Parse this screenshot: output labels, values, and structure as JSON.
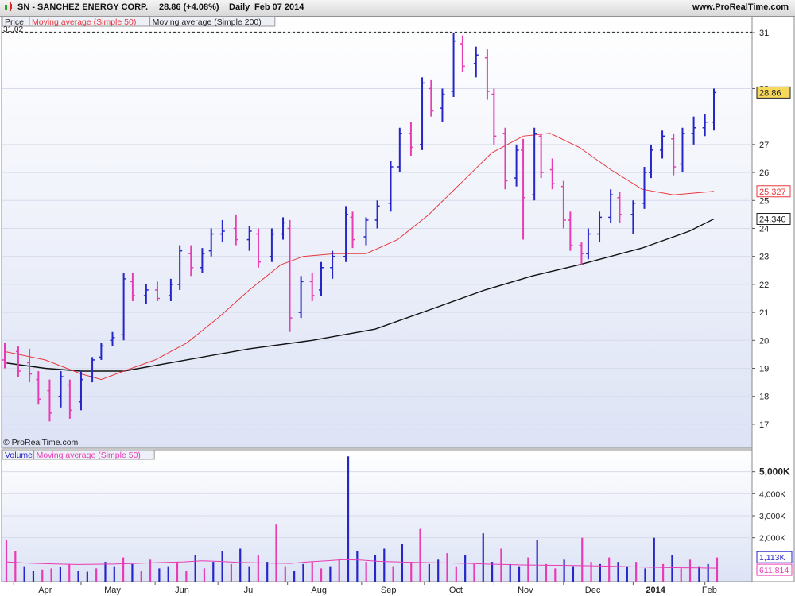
{
  "header": {
    "symbol_title": "SN - SANCHEZ ENERGY CORP.",
    "price_change": "28.86 (+4.08%)",
    "period": "Daily",
    "date": "Feb 07 2014",
    "website": "www.ProRealTime.com"
  },
  "price_panel": {
    "legend": [
      "Price",
      "Moving average (Simple 50)",
      "Moving average (Simple 200)"
    ],
    "top_value_label": "31.02",
    "copyright": "© ProRealTime.com",
    "last_price_tag": "28.86",
    "ma50_tag": "25.327",
    "ma200_tag": "24.340"
  },
  "volume_panel": {
    "legend": [
      "Volume",
      "Moving average (Simple 50)"
    ],
    "last_volume_tag": "1,113K",
    "vol_ma_tag": "611,814"
  },
  "colors": {
    "up_bar": "#2626c8",
    "down_bar": "#e83cb4",
    "ma50": "#e8383c",
    "ma200": "#111111",
    "vol_ma": "#e83cb4",
    "panel_bg_top": "#ffffff",
    "panel_bg_bottom": "#dde3f5"
  },
  "chart_data": [
    {
      "type": "ohlc",
      "title": "SN - SANCHEZ ENERGY CORP. Daily",
      "y_ticks": [
        "17",
        "18",
        "19",
        "20",
        "21",
        "22",
        "23",
        "24",
        "25",
        "26",
        "27",
        "29",
        "31"
      ],
      "ylim": [
        16.6,
        31.2
      ],
      "x_labels": [
        "Apr",
        "May",
        "Jun",
        "Jul",
        "Aug",
        "Sep",
        "Oct",
        "Nov",
        "Dec",
        "2014",
        "Feb"
      ],
      "x_range": [
        "2013-03-28",
        "2014-02-07"
      ],
      "grid": true,
      "series": [
        {
          "name": "Price",
          "type": "ohlc",
          "points": [
            [
              "2013-03-28",
              19.3,
              19.9,
              19.0,
              19.2
            ],
            [
              "2013-04-03",
              19.6,
              19.8,
              18.7,
              18.9
            ],
            [
              "2013-04-08",
              19.2,
              19.7,
              18.5,
              18.8
            ],
            [
              "2013-04-12",
              18.6,
              18.9,
              17.7,
              17.9
            ],
            [
              "2013-04-17",
              18.2,
              18.6,
              17.1,
              17.4
            ],
            [
              "2013-04-22",
              18.0,
              18.9,
              17.6,
              18.7
            ],
            [
              "2013-04-26",
              18.4,
              18.6,
              17.2,
              17.5
            ],
            [
              "2013-05-01",
              17.8,
              18.9,
              17.5,
              18.6
            ],
            [
              "2013-05-06",
              18.7,
              19.4,
              18.5,
              19.3
            ],
            [
              "2013-05-10",
              19.4,
              19.9,
              19.3,
              19.8
            ],
            [
              "2013-05-15",
              20.0,
              20.3,
              19.8,
              20.1
            ],
            [
              "2013-05-20",
              20.2,
              22.4,
              20.0,
              22.2
            ],
            [
              "2013-05-24",
              22.1,
              22.4,
              21.4,
              21.6
            ],
            [
              "2013-05-30",
              21.6,
              22.0,
              21.3,
              21.8
            ],
            [
              "2013-06-04",
              21.8,
              22.1,
              21.4,
              21.5
            ],
            [
              "2013-06-10",
              21.6,
              22.2,
              21.4,
              22.0
            ],
            [
              "2013-06-14",
              22.0,
              23.4,
              21.8,
              23.2
            ],
            [
              "2013-06-19",
              23.1,
              23.4,
              22.3,
              22.6
            ],
            [
              "2013-06-24",
              22.6,
              23.3,
              22.4,
              23.1
            ],
            [
              "2013-06-28",
              23.2,
              24.0,
              23.0,
              23.8
            ],
            [
              "2013-07-03",
              23.8,
              24.3,
              23.5,
              23.9
            ],
            [
              "2013-07-09",
              24.0,
              24.5,
              23.4,
              23.6
            ],
            [
              "2013-07-15",
              23.6,
              24.1,
              23.2,
              23.9
            ],
            [
              "2013-07-19",
              23.8,
              24.0,
              22.6,
              22.8
            ],
            [
              "2013-07-25",
              23.0,
              24.0,
              22.8,
              23.8
            ],
            [
              "2013-07-30",
              23.8,
              24.4,
              23.6,
              24.2
            ],
            [
              "2013-08-02",
              24.0,
              24.3,
              20.3,
              20.8
            ],
            [
              "2013-08-07",
              21.0,
              22.3,
              20.8,
              22.1
            ],
            [
              "2013-08-12",
              22.1,
              22.4,
              21.4,
              21.6
            ],
            [
              "2013-08-16",
              21.8,
              22.8,
              21.6,
              22.6
            ],
            [
              "2013-08-21",
              22.6,
              23.2,
              22.2,
              23.0
            ],
            [
              "2013-08-27",
              23.0,
              24.8,
              22.8,
              24.5
            ],
            [
              "2013-08-30",
              24.4,
              24.6,
              23.3,
              23.6
            ],
            [
              "2013-09-05",
              23.7,
              24.4,
              23.4,
              24.3
            ],
            [
              "2013-09-10",
              24.3,
              25.0,
              24.0,
              24.8
            ],
            [
              "2013-09-16",
              24.9,
              26.4,
              24.6,
              26.2
            ],
            [
              "2013-09-20",
              26.2,
              27.6,
              26.0,
              27.4
            ],
            [
              "2013-09-25",
              27.4,
              27.8,
              26.6,
              26.9
            ],
            [
              "2013-09-30",
              27.0,
              29.4,
              26.8,
              29.2
            ],
            [
              "2013-10-04",
              29.0,
              29.3,
              28.0,
              28.2
            ],
            [
              "2013-10-09",
              28.3,
              29.0,
              27.8,
              28.8
            ],
            [
              "2013-10-14",
              28.9,
              31.0,
              28.7,
              30.7
            ],
            [
              "2013-10-18",
              30.6,
              30.9,
              29.6,
              29.8
            ],
            [
              "2013-10-24",
              29.9,
              30.5,
              29.4,
              30.2
            ],
            [
              "2013-10-29",
              30.1,
              30.4,
              28.6,
              28.9
            ],
            [
              "2013-11-01",
              28.8,
              29.0,
              27.0,
              27.3
            ],
            [
              "2013-11-06",
              27.4,
              27.6,
              25.4,
              25.7
            ],
            [
              "2013-11-11",
              25.8,
              27.0,
              25.5,
              26.8
            ],
            [
              "2013-11-14",
              26.8,
              27.2,
              23.6,
              25.1
            ],
            [
              "2013-11-19",
              25.2,
              27.6,
              25.0,
              27.4
            ],
            [
              "2013-11-22",
              27.3,
              27.4,
              25.8,
              26.0
            ],
            [
              "2013-11-27",
              26.1,
              26.5,
              25.4,
              25.6
            ],
            [
              "2013-12-02",
              25.5,
              25.7,
              24.0,
              24.3
            ],
            [
              "2013-12-05",
              24.3,
              24.6,
              23.2,
              23.4
            ],
            [
              "2013-12-10",
              23.4,
              23.5,
              22.7,
              23.1
            ],
            [
              "2013-12-13",
              23.1,
              24.0,
              22.9,
              23.8
            ],
            [
              "2013-12-18",
              23.8,
              24.6,
              23.5,
              24.4
            ],
            [
              "2013-12-23",
              24.4,
              25.4,
              24.2,
              25.2
            ],
            [
              "2013-12-27",
              25.1,
              25.3,
              24.2,
              24.5
            ],
            [
              "2014-01-02",
              24.5,
              25.0,
              23.8,
              24.9
            ],
            [
              "2014-01-07",
              24.9,
              26.2,
              24.7,
              26.0
            ],
            [
              "2014-01-10",
              26.0,
              27.0,
              25.8,
              26.8
            ],
            [
              "2014-01-15",
              26.8,
              27.5,
              26.5,
              27.3
            ],
            [
              "2014-01-20",
              27.2,
              27.4,
              25.9,
              26.2
            ],
            [
              "2014-01-24",
              26.3,
              27.6,
              26.0,
              27.4
            ],
            [
              "2014-01-29",
              27.4,
              28.0,
              27.0,
              27.6
            ],
            [
              "2014-02-03",
              27.6,
              28.1,
              27.3,
              27.8
            ],
            [
              "2014-02-07",
              27.8,
              29.0,
              27.5,
              28.86
            ]
          ]
        },
        {
          "name": "Moving average (Simple 50)",
          "type": "line",
          "points": [
            [
              "2013-03-28",
              19.6
            ],
            [
              "2013-04-15",
              19.3
            ],
            [
              "2013-05-01",
              18.8
            ],
            [
              "2013-05-10",
              18.6
            ],
            [
              "2013-05-20",
              18.9
            ],
            [
              "2013-06-03",
              19.3
            ],
            [
              "2013-06-17",
              19.9
            ],
            [
              "2013-07-01",
              20.8
            ],
            [
              "2013-07-15",
              21.8
            ],
            [
              "2013-07-29",
              22.7
            ],
            [
              "2013-08-08",
              23.0
            ],
            [
              "2013-08-22",
              23.1
            ],
            [
              "2013-09-05",
              23.1
            ],
            [
              "2013-09-19",
              23.6
            ],
            [
              "2013-10-03",
              24.5
            ],
            [
              "2013-10-17",
              25.6
            ],
            [
              "2013-10-31",
              26.7
            ],
            [
              "2013-11-14",
              27.3
            ],
            [
              "2013-11-26",
              27.4
            ],
            [
              "2013-12-09",
              26.9
            ],
            [
              "2013-12-23",
              26.1
            ],
            [
              "2014-01-06",
              25.4
            ],
            [
              "2014-01-20",
              25.2
            ],
            [
              "2014-02-07",
              25.327
            ]
          ]
        },
        {
          "name": "Moving average (Simple 200)",
          "type": "line",
          "points": [
            [
              "2013-03-28",
              19.2
            ],
            [
              "2013-04-15",
              19.0
            ],
            [
              "2013-05-01",
              18.9
            ],
            [
              "2013-05-20",
              18.9
            ],
            [
              "2013-06-17",
              19.3
            ],
            [
              "2013-07-15",
              19.7
            ],
            [
              "2013-08-12",
              20.0
            ],
            [
              "2013-09-09",
              20.4
            ],
            [
              "2013-10-07",
              21.2
            ],
            [
              "2013-10-28",
              21.8
            ],
            [
              "2013-11-18",
              22.3
            ],
            [
              "2013-12-09",
              22.7
            ],
            [
              "2014-01-06",
              23.3
            ],
            [
              "2014-01-27",
              23.9
            ],
            [
              "2014-02-07",
              24.34
            ]
          ]
        }
      ]
    },
    {
      "type": "bar",
      "title": "Volume",
      "y_ticks": [
        "2,000K",
        "3,000K",
        "4,000K",
        "5,000K"
      ],
      "ylim": [
        0,
        6000
      ],
      "series": [
        {
          "name": "Volume",
          "values": [
            1900,
            1400,
            700,
            500,
            550,
            600,
            650,
            800,
            500,
            450,
            600,
            900,
            700,
            1100,
            800,
            500,
            1000,
            600,
            700,
            900,
            500,
            1200,
            600,
            900,
            1400,
            800,
            1500,
            700,
            1200,
            900,
            2600,
            700,
            500,
            800,
            900,
            600,
            700,
            1000,
            5700,
            1400,
            900,
            1200,
            1500,
            700,
            1700,
            900,
            2400,
            800,
            1000,
            1300,
            700,
            1200,
            800,
            2200,
            900,
            1500,
            800,
            700,
            1100,
            1900,
            800,
            600,
            1000,
            700,
            2000,
            900,
            800,
            1100,
            900,
            700,
            900,
            600,
            2000,
            800,
            1200,
            600,
            1000,
            700,
            800,
            1100
          ]
        },
        {
          "name": "Moving average (Simple 50)",
          "values_points": [
            900,
            850,
            820,
            800,
            780,
            790,
            800,
            820,
            850,
            880,
            900,
            950,
            920,
            880,
            860,
            840,
            830,
            900,
            950,
            1000,
            980,
            920,
            900,
            880,
            860,
            850,
            830,
            800,
            780,
            760,
            750,
            740,
            730,
            720,
            700,
            680,
            660,
            640,
            630,
            620,
            611.814
          ]
        }
      ]
    }
  ]
}
